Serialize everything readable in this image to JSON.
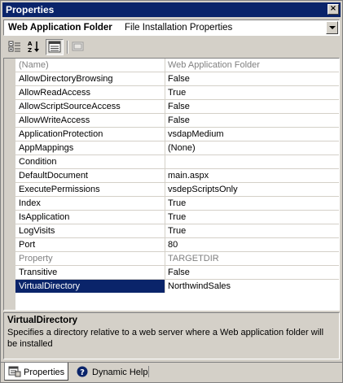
{
  "window": {
    "title": "Properties",
    "close_glyph": "×"
  },
  "object_selector": {
    "object_name": "Web Application Folder",
    "object_type": "File Installation Properties"
  },
  "toolbar": {
    "buttons": [
      {
        "name": "categorized-icon",
        "pressed": false
      },
      {
        "name": "alphabetical-icon",
        "pressed": false
      },
      {
        "name": "properties-icon",
        "pressed": true
      },
      {
        "name": "property-pages-icon",
        "pressed": false
      }
    ]
  },
  "properties": [
    {
      "name": "(Name)",
      "value": "Web Application Folder",
      "readonly": true
    },
    {
      "name": "AllowDirectoryBrowsing",
      "value": "False"
    },
    {
      "name": "AllowReadAccess",
      "value": "True"
    },
    {
      "name": "AllowScriptSourceAccess",
      "value": "False"
    },
    {
      "name": "AllowWriteAccess",
      "value": "False"
    },
    {
      "name": "ApplicationProtection",
      "value": "vsdapMedium"
    },
    {
      "name": "AppMappings",
      "value": "(None)"
    },
    {
      "name": "Condition",
      "value": ""
    },
    {
      "name": "DefaultDocument",
      "value": "main.aspx"
    },
    {
      "name": "ExecutePermissions",
      "value": "vsdepScriptsOnly"
    },
    {
      "name": "Index",
      "value": "True"
    },
    {
      "name": "IsApplication",
      "value": "True"
    },
    {
      "name": "LogVisits",
      "value": "True"
    },
    {
      "name": "Port",
      "value": "80"
    },
    {
      "name": "Property",
      "value": "TARGETDIR",
      "readonly": true
    },
    {
      "name": "Transitive",
      "value": "False"
    },
    {
      "name": "VirtualDirectory",
      "value": "NorthwindSales",
      "selected": true
    }
  ],
  "description": {
    "title": "VirtualDirectory",
    "text": "Specifies a directory relative to a web server where a Web application folder will be installed"
  },
  "tabs": [
    {
      "label": "Properties",
      "icon": "properties-window-icon",
      "active": true
    },
    {
      "label": "Dynamic Help",
      "icon": "help-icon",
      "active": false
    }
  ],
  "colors": {
    "selection": "#0a246a",
    "titlebar": "#0a246a",
    "chrome": "#d4d0c8",
    "readonly_text": "#808080"
  }
}
